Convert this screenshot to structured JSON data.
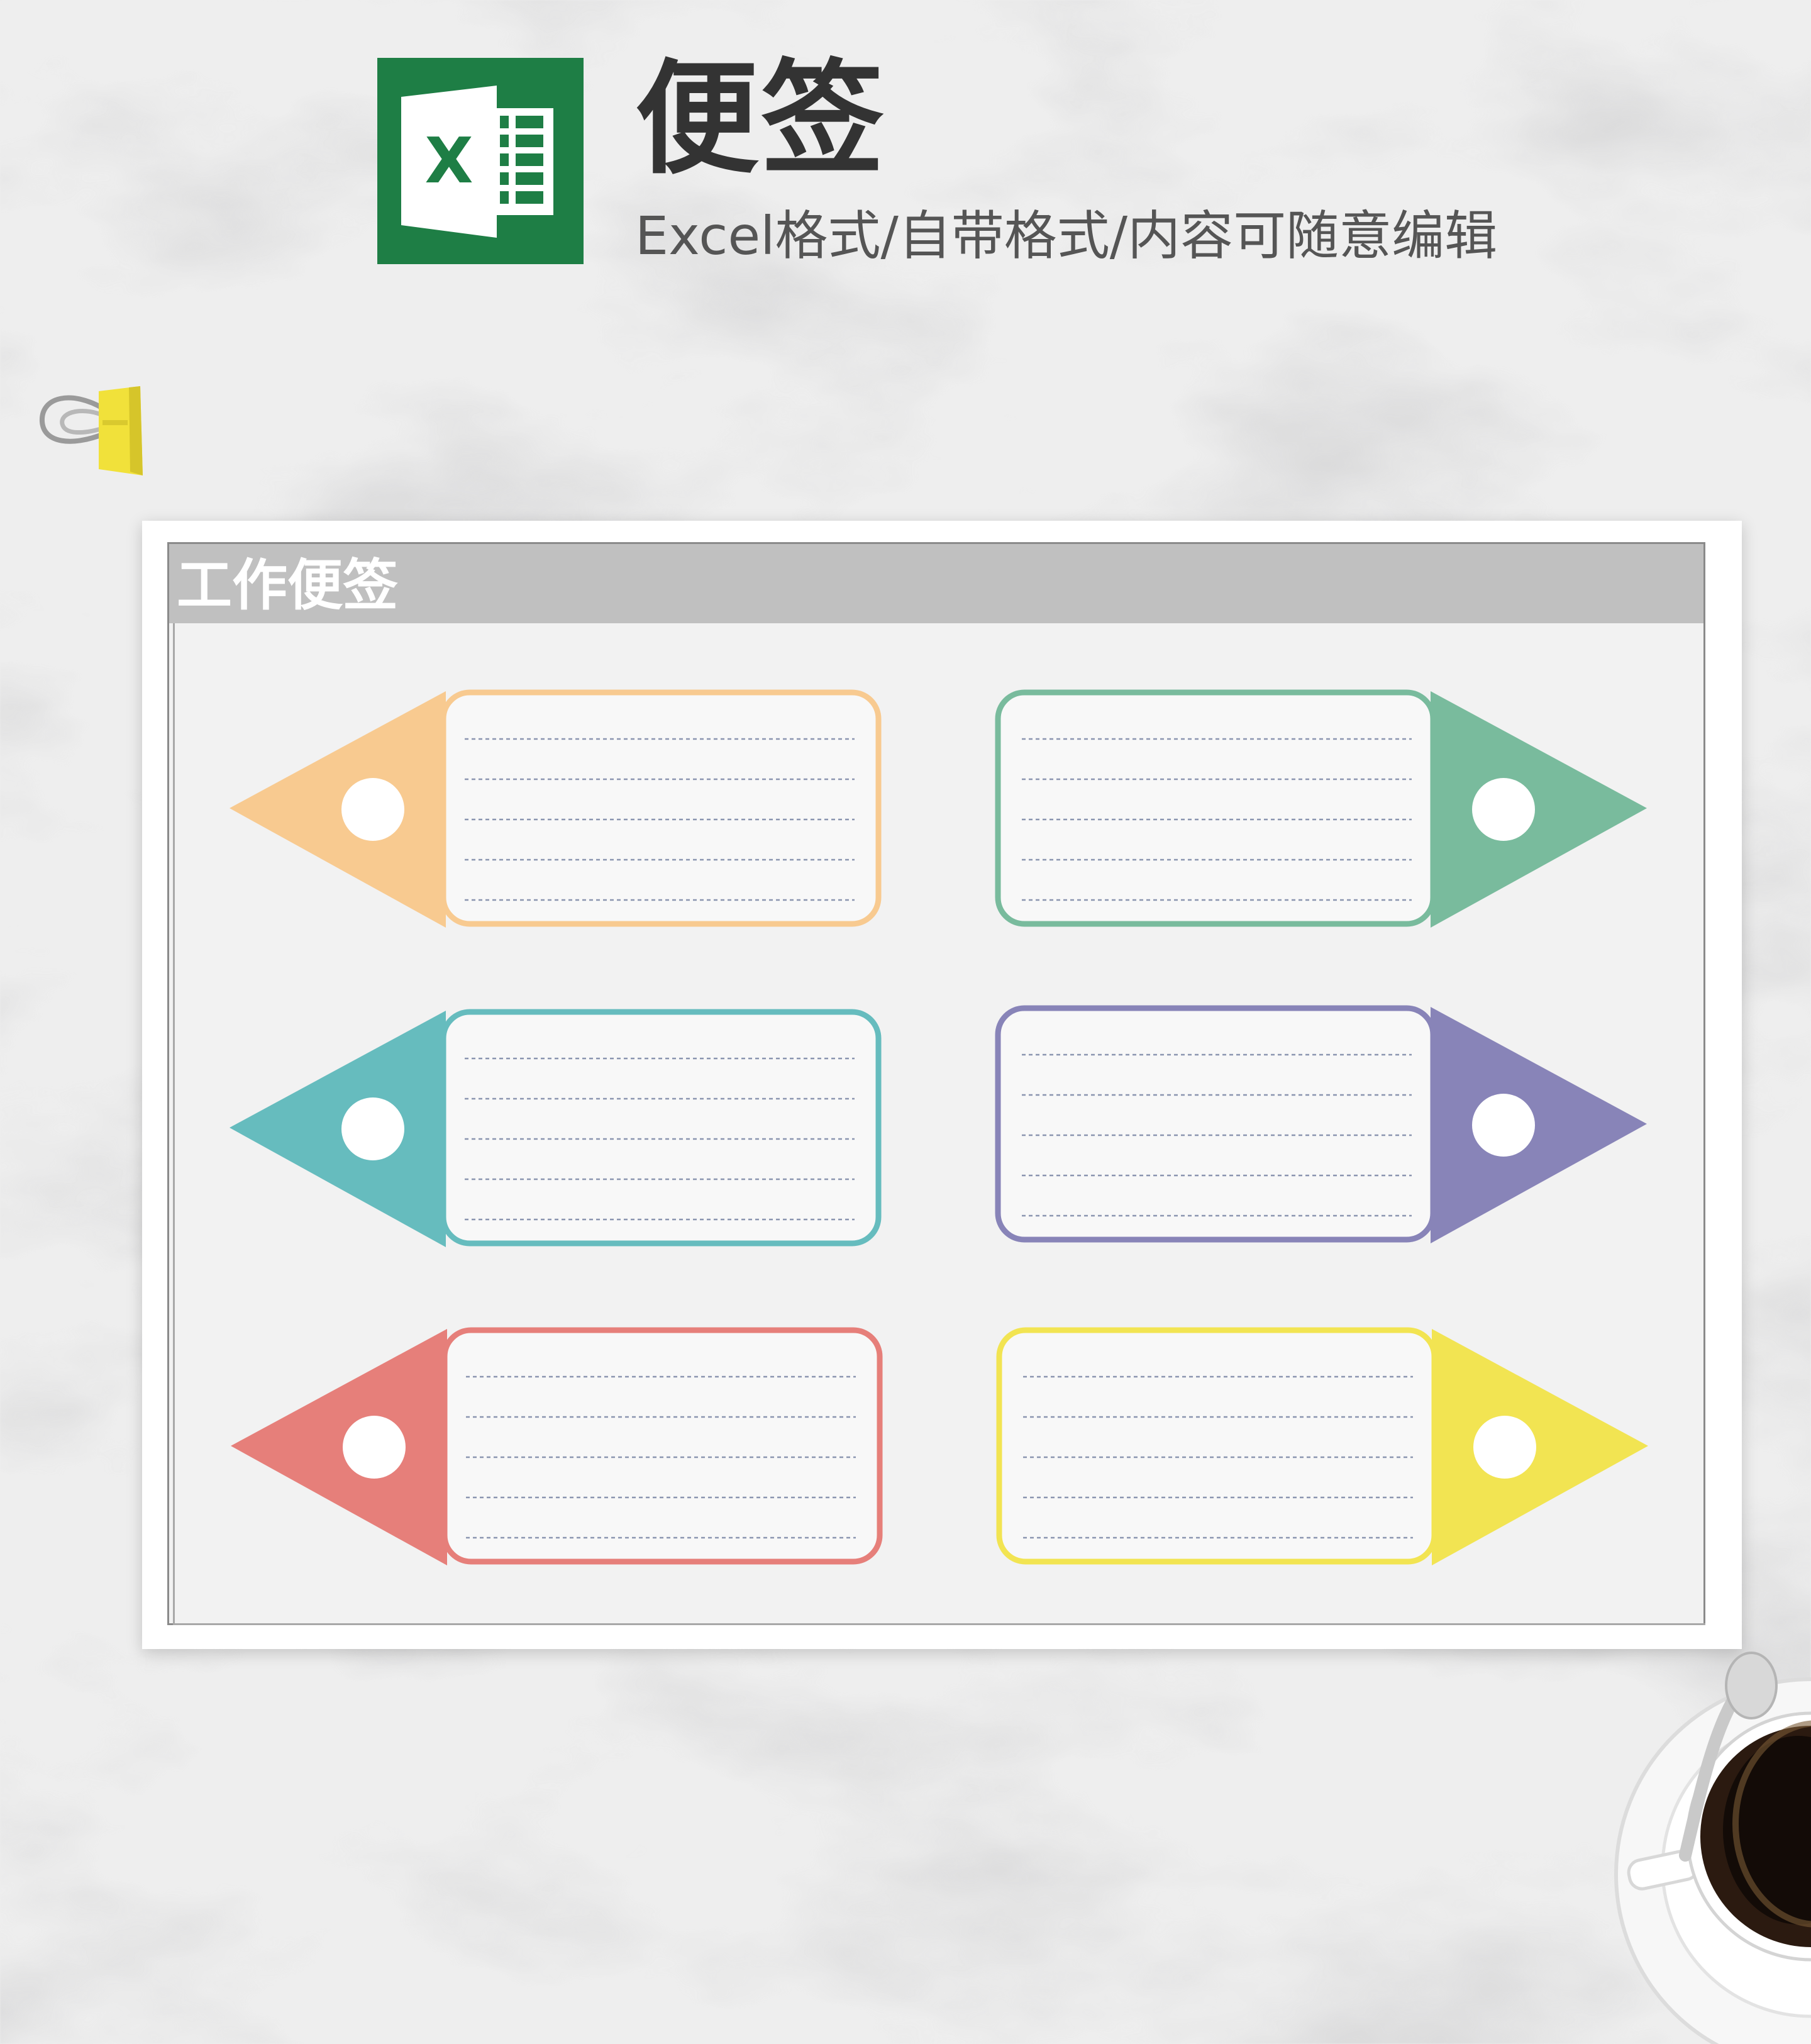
{
  "header": {
    "title": "便签",
    "subtitle": "Excel格式/自带格式/内容可随意编辑",
    "logo": {
      "letter": "X",
      "icon": "excel-logo-icon",
      "color": "#1e7e45"
    }
  },
  "sheet": {
    "panel_title": "工作便签",
    "tags": [
      {
        "color": "#f8ca90",
        "lines": 5,
        "point": "left"
      },
      {
        "color": "#79bb9d",
        "lines": 5,
        "point": "right"
      },
      {
        "color": "#66bcbe",
        "lines": 5,
        "point": "left"
      },
      {
        "color": "#8884b8",
        "lines": 5,
        "point": "right"
      },
      {
        "color": "#e67f7a",
        "lines": 5,
        "point": "left"
      },
      {
        "color": "#f2e452",
        "lines": 5,
        "point": "right"
      }
    ],
    "line_color": "#8b95b0"
  },
  "decor": {
    "clip_icon": "binder-clip-icon",
    "coffee_icon": "coffee-cup-icon"
  }
}
